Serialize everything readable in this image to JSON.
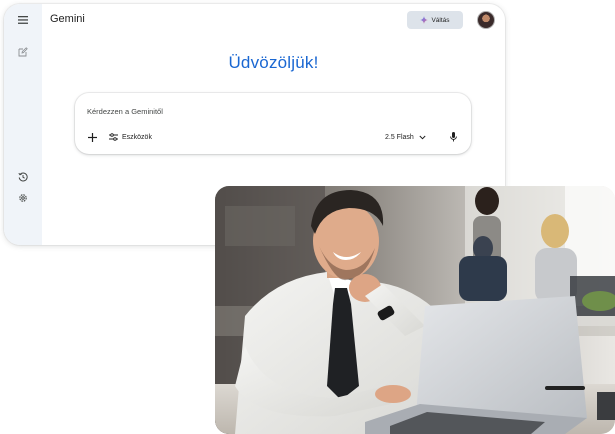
{
  "app": {
    "title": "Gemini",
    "upgrade_label": "Váltás",
    "welcome": "Üdvözöljük!"
  },
  "sidebar": {
    "icons": [
      "menu-icon",
      "new-chat-icon",
      "history-icon",
      "settings-icon"
    ]
  },
  "prompt": {
    "placeholder": "Kérdezzen a Geminitől",
    "tools_label": "Eszközök",
    "model_label": "2.5 Flash"
  },
  "colors": {
    "accent_blue": "#1a67d2",
    "sidebar_bg": "#f0f4f9",
    "upgrade_bg": "#dde3ea"
  }
}
